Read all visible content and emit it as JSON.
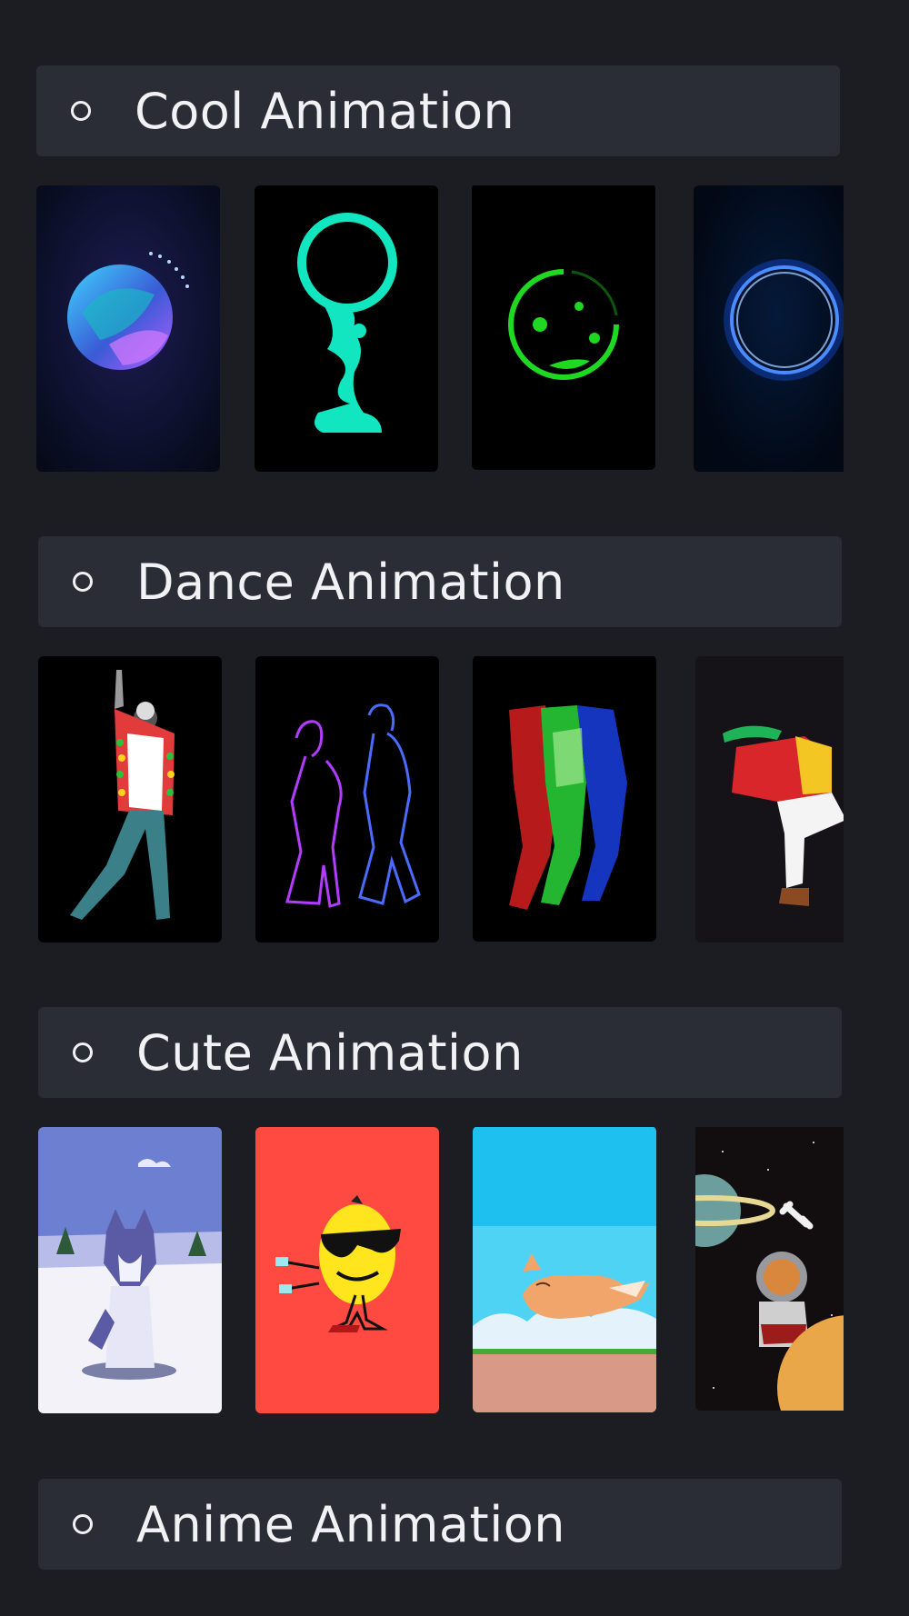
{
  "sections": [
    {
      "title": "Cool Animation",
      "items": [
        {
          "name": "gradient-orb"
        },
        {
          "name": "liquid-ring"
        },
        {
          "name": "green-smiley"
        },
        {
          "name": "blue-glow-ring"
        }
      ]
    },
    {
      "title": "Dance Animation",
      "items": [
        {
          "name": "dancing-man"
        },
        {
          "name": "neon-dancers"
        },
        {
          "name": "rgb-dancers"
        },
        {
          "name": "cartoon-dancer"
        }
      ]
    },
    {
      "title": "Cute Animation",
      "items": [
        {
          "name": "husky-dog"
        },
        {
          "name": "lemon-sunglasses"
        },
        {
          "name": "running-fox"
        },
        {
          "name": "space-shiba"
        }
      ]
    },
    {
      "title": "Anime Animation",
      "items": []
    }
  ]
}
